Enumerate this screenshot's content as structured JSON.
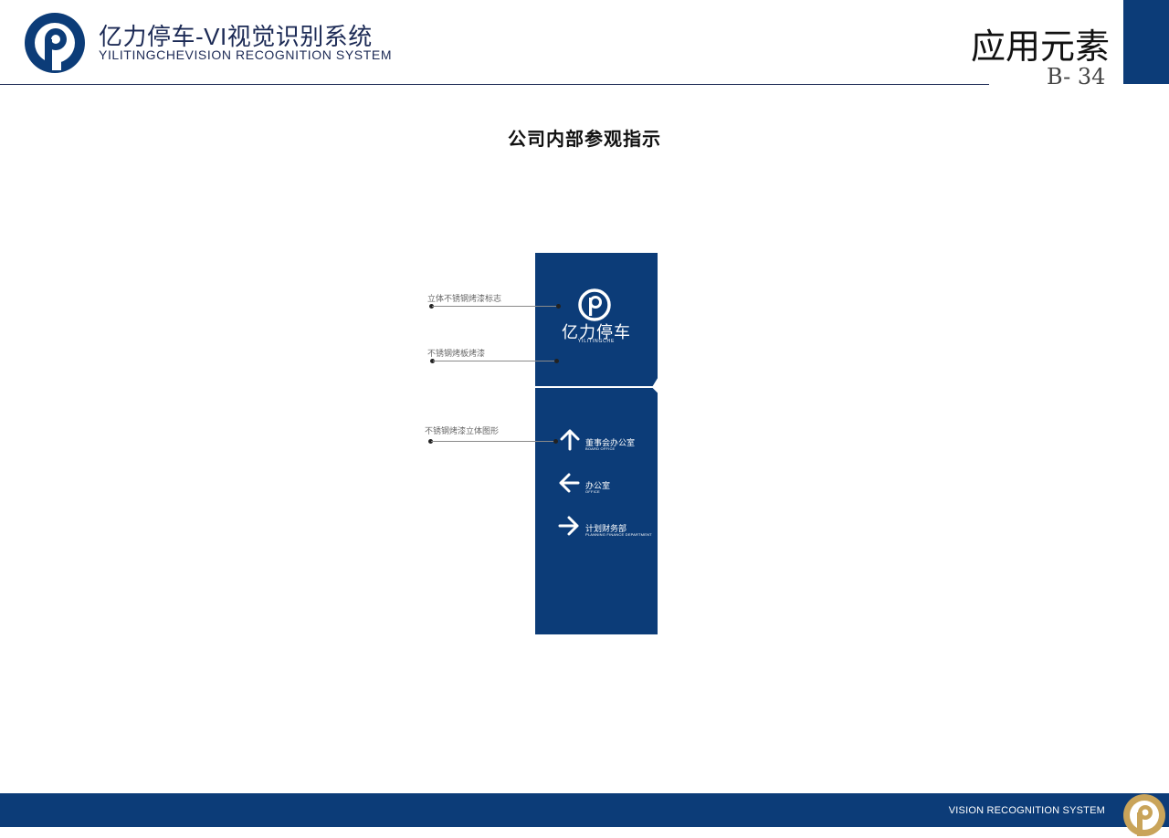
{
  "header": {
    "brand_title": "亿力停车-VI视觉识别系统",
    "brand_subtitle": "YILITINGCHEVISION RECOGNITION SYSTEM",
    "section_title": "应用元素",
    "page_number": "B- 34"
  },
  "page_title": "公司内部参观指示",
  "sign": {
    "brand_cn": "亿力停车",
    "brand_en": "YILITINGCHE",
    "directions": [
      {
        "icon": "arrow-up-icon",
        "label_cn": "董事会办公室",
        "label_en": "BOARD OFFICE"
      },
      {
        "icon": "arrow-left-icon",
        "label_cn": "办公室",
        "label_en": "OFFICE"
      },
      {
        "icon": "arrow-right-icon",
        "label_cn": "计划财务部",
        "label_en": "PLANNING FINANCE DEPARTMENT"
      }
    ]
  },
  "callouts": [
    {
      "label": "立体不锈钢烤漆标志"
    },
    {
      "label": "不锈钢烤板烤漆"
    },
    {
      "label": "不锈钢烤漆立体图形"
    }
  ],
  "footer": {
    "text": "VISION RECOGNITION SYSTEM"
  },
  "colors": {
    "brand_blue": "#0c3c78",
    "gold": "#c9a45a"
  }
}
